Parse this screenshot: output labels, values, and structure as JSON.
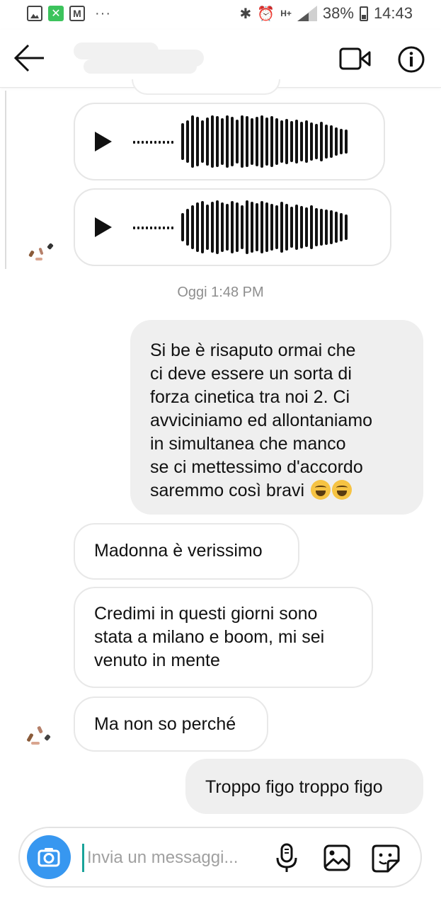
{
  "status_bar": {
    "battery": "38%",
    "time": "14:43",
    "network": "H+",
    "icons": [
      "gallery-icon",
      "x-app-icon",
      "mail-icon",
      "more-dots-icon",
      "bluetooth-icon",
      "alarm-icon",
      "signal-icon",
      "battery-icon"
    ]
  },
  "header": {
    "icons": [
      "back-arrow-icon",
      "video-call-icon",
      "info-icon"
    ]
  },
  "conversation": {
    "timestamp": "Oggi 1:48 PM",
    "voice_messages": [
      {
        "icon": "play-icon"
      },
      {
        "icon": "play-icon"
      }
    ],
    "sent_long": "Si be è risaputo ormai che ci deve essere un sorta di forza cinetica tra noi 2. Ci avviciniamo ed allontaniamo in simultanea che manco se ci mettessimo d'accordo saremmo così bravi",
    "sent_long_lines": [
      "Si be è risaputo ormai che",
      "ci deve essere un sorta di",
      "forza cinetica tra noi 2. Ci",
      "avviciniamo ed allontaniamo",
      "in simultanea che manco",
      "se ci mettessimo d'accordo",
      "saremmo così bravi"
    ],
    "emoji": "😂😂",
    "received": [
      {
        "lines": [
          "Madonna è verissimo"
        ]
      },
      {
        "lines": [
          "Credimi in questi giorni sono",
          "stata a milano e boom, mi sei",
          "venuto in mente"
        ]
      },
      {
        "lines": [
          "Ma non so perché"
        ]
      }
    ],
    "sent_last": "Troppo figo troppo figo"
  },
  "composer": {
    "placeholder": "Invia un messaggi...",
    "icons": [
      "camera-icon",
      "microphone-icon",
      "gallery-icon",
      "sticker-icon"
    ]
  },
  "colors": {
    "accent": "#3797f0",
    "bubble_out": "#efefef",
    "bubble_in_border": "#e8e8e8",
    "timestamp": "#8e8e8e",
    "cursor": "#1aa39a"
  }
}
